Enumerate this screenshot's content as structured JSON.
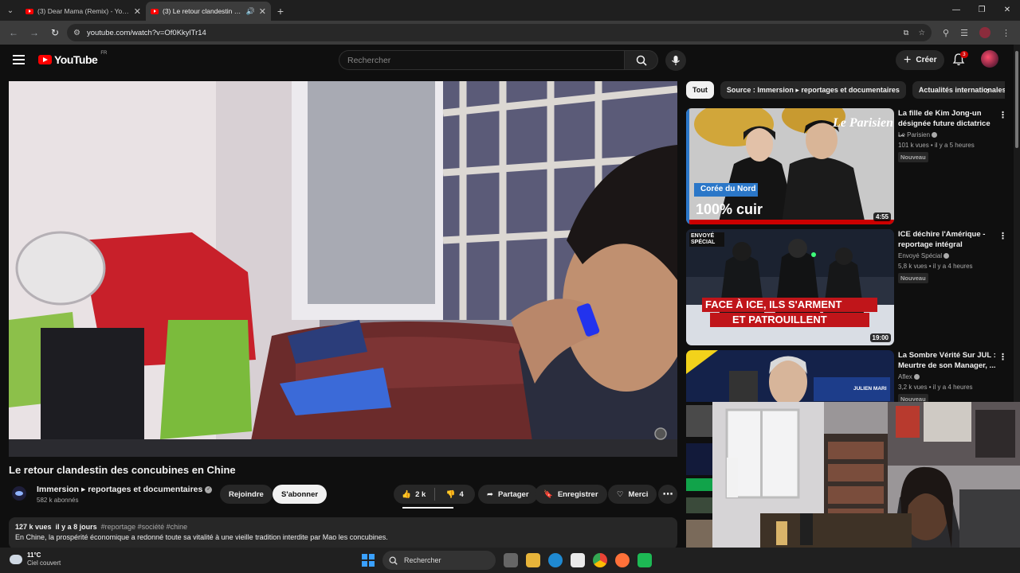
{
  "browser": {
    "tabs": [
      {
        "title": "(3) Dear Mama (Remix) - YouTube",
        "active": false,
        "audio": false
      },
      {
        "title": "(3) Le retour clandestin des concubines en Chine",
        "active": true,
        "audio": true
      }
    ],
    "url": "youtube.com/watch?v=Of0KkylTr14"
  },
  "youtube": {
    "logo_text": "YouTube",
    "country_code": "FR",
    "search_placeholder": "Rechercher",
    "create_label": "Créer",
    "notification_count": "3"
  },
  "video": {
    "title": "Le retour clandestin des concubines en Chine",
    "channel": "Immersion ▸ reportages et documentaires",
    "subscribers": "582 k abonnés",
    "join_label": "Rejoindre",
    "subscribe_label": "S'abonner",
    "likes": "2 k",
    "dislikes": "4",
    "share_label": "Partager",
    "save_label": "Enregistrer",
    "thanks_label": "Merci",
    "description": {
      "views": "127 k vues",
      "age": "il y a 8 jours",
      "tags": "#reportage #société #chine",
      "line1": "En Chine, la prospérité économique a redonné toute sa vitalité à une vieille tradition interdite par Mao  les concubines."
    }
  },
  "chips": [
    "Tout",
    "Source : Immersion ▸ reportages et documentaires",
    "Actualités internationales"
  ],
  "recommendations": [
    {
      "title": "La fille de Kim Jong-un désignée future dictatrice ...",
      "channel": "Le Parisien",
      "views": "101 k vues",
      "age": "il y a 5 heures",
      "badge": "Nouveau",
      "duration": "4:55",
      "thumb_brand": "Le Parisien",
      "thumb_tag": "Corée du Nord",
      "thumb_caption": "100% cuir"
    },
    {
      "title": "ICE déchire l'Amérique - reportage intégral",
      "channel": "Envoyé Spécial",
      "views": "5,8 k vues",
      "age": "il y a 4 heures",
      "badge": "Nouveau",
      "duration": "19:00",
      "thumb_brand_top": "ENVOYÉ",
      "thumb_brand_bottom": "SPÉCIAL",
      "thumb_line1": "FACE À ICE, ILS S'ARMENT",
      "thumb_line2": "ET PATROUILLENT"
    },
    {
      "title": "La Sombre Vérité Sur JUL : Meurtre de son Manager, ...",
      "channel": "Aflex",
      "views": "3,2 k vues",
      "age": "il y a 4 heures",
      "badge": "Nouveau",
      "thumb_name": "JULIEN MARI"
    }
  ],
  "taskbar": {
    "temperature": "11°C",
    "condition": "Ciel couvert",
    "search_label": "Rechercher"
  }
}
